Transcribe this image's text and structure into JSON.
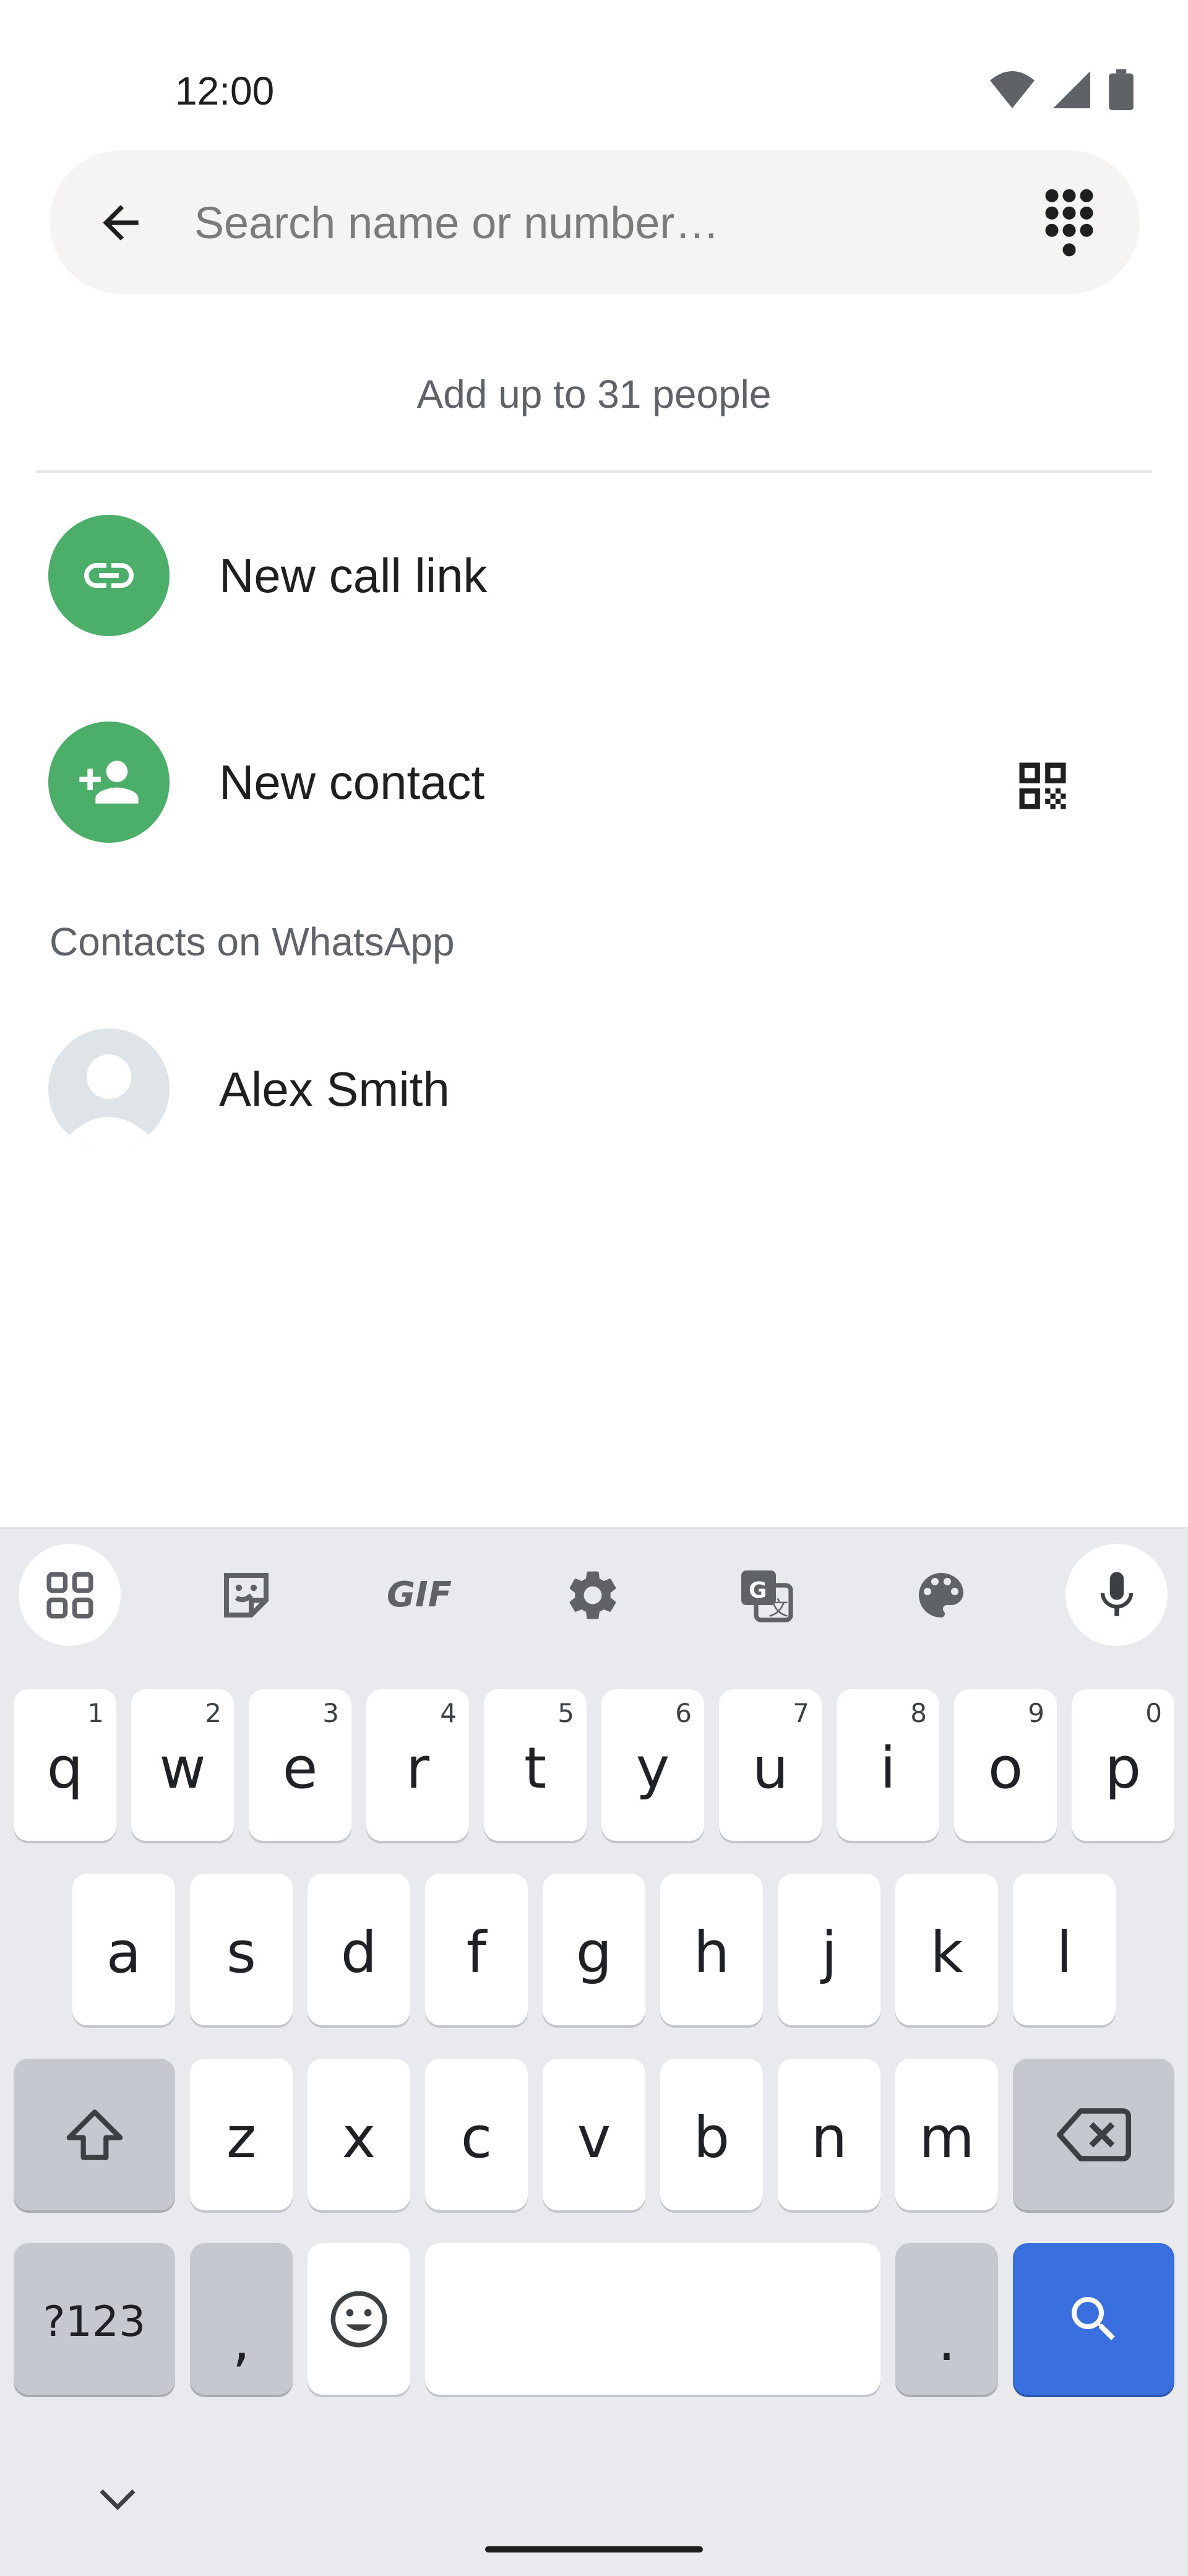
{
  "status_bar": {
    "time": "12:00",
    "icons": [
      "wifi-icon",
      "cellular-signal-icon",
      "battery-icon"
    ]
  },
  "search": {
    "placeholder": "Search name or number…",
    "value": ""
  },
  "hint": "Add up to 31 people",
  "actions": [
    {
      "label": "New call link",
      "icon": "link-icon"
    },
    {
      "label": "New contact",
      "icon": "add-person-icon",
      "trailing_icon": "qr-code-icon"
    }
  ],
  "section_header": "Contacts on WhatsApp",
  "contacts": [
    {
      "name": "Alex Smith"
    }
  ],
  "keyboard": {
    "toolbar": [
      "apps-grid-icon",
      "sticker-icon",
      "gif-icon",
      "settings-icon",
      "translate-icon",
      "palette-icon",
      "microphone-icon"
    ],
    "gif_label": "GIF",
    "row1": [
      {
        "key": "q",
        "hint": "1"
      },
      {
        "key": "w",
        "hint": "2"
      },
      {
        "key": "e",
        "hint": "3"
      },
      {
        "key": "r",
        "hint": "4"
      },
      {
        "key": "t",
        "hint": "5"
      },
      {
        "key": "y",
        "hint": "6"
      },
      {
        "key": "u",
        "hint": "7"
      },
      {
        "key": "i",
        "hint": "8"
      },
      {
        "key": "o",
        "hint": "9"
      },
      {
        "key": "p",
        "hint": "0"
      }
    ],
    "row2": [
      "a",
      "s",
      "d",
      "f",
      "g",
      "h",
      "j",
      "k",
      "l"
    ],
    "row3": [
      "z",
      "x",
      "c",
      "v",
      "b",
      "n",
      "m"
    ],
    "symbols_label": "?123",
    "comma": ",",
    "period": ".",
    "colors": {
      "action_key": "#3a6fdf",
      "accent_green": "#4caf69"
    }
  }
}
